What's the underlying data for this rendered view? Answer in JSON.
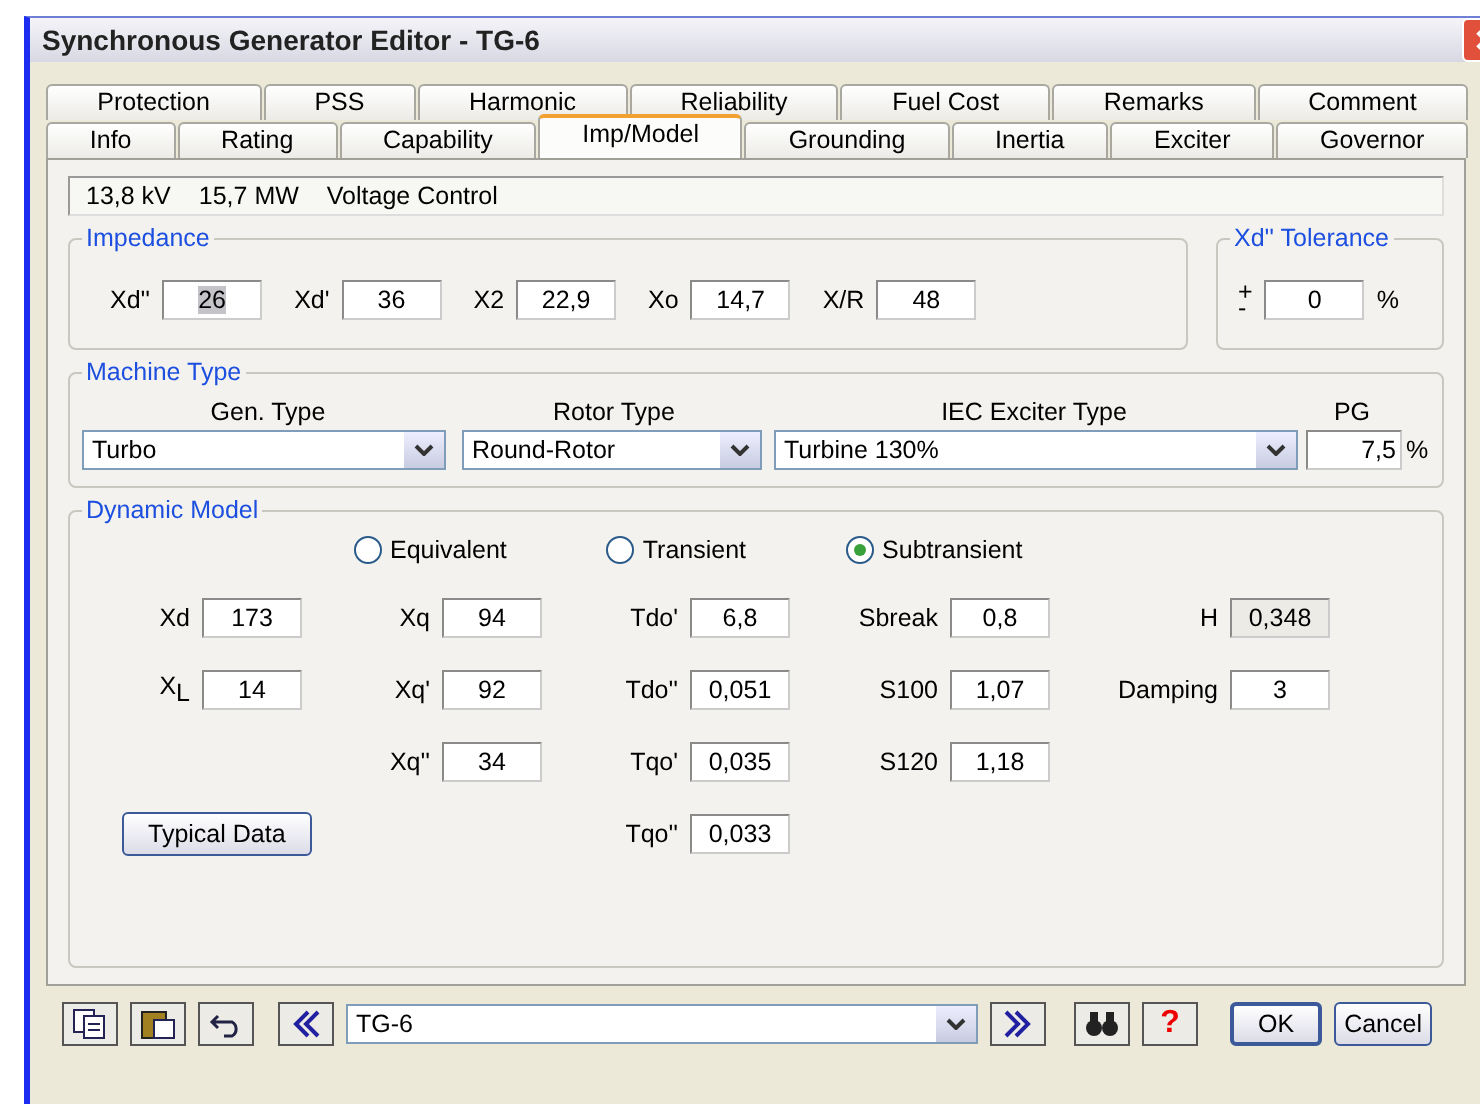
{
  "window": {
    "title": "Synchronous Generator Editor - TG-6"
  },
  "tab_rows": [
    [
      {
        "label": "Protection",
        "selected": false
      },
      {
        "label": "PSS",
        "selected": false
      },
      {
        "label": "Harmonic",
        "selected": false
      },
      {
        "label": "Reliability",
        "selected": false
      },
      {
        "label": "Fuel Cost",
        "selected": false
      },
      {
        "label": "Remarks",
        "selected": false
      },
      {
        "label": "Comment",
        "selected": false
      }
    ],
    [
      {
        "label": "Info",
        "selected": false
      },
      {
        "label": "Rating",
        "selected": false
      },
      {
        "label": "Capability",
        "selected": false
      },
      {
        "label": "Imp/Model",
        "selected": true
      },
      {
        "label": "Grounding",
        "selected": false
      },
      {
        "label": "Inertia",
        "selected": false
      },
      {
        "label": "Exciter",
        "selected": false
      },
      {
        "label": "Governor",
        "selected": false
      }
    ]
  ],
  "info_bar": [
    "13,8 kV",
    "15,7 MW",
    "Voltage Control"
  ],
  "impedance": {
    "title": "Impedance",
    "fields": [
      {
        "label": "Xd''",
        "value": "26",
        "highlighted": true
      },
      {
        "label": "Xd'",
        "value": "36",
        "highlighted": false
      },
      {
        "label": "X2",
        "value": "22,9",
        "highlighted": false
      },
      {
        "label": "Xo",
        "value": "14,7",
        "highlighted": false
      },
      {
        "label": "X/R",
        "value": "48",
        "highlighted": false
      }
    ]
  },
  "tolerance": {
    "title": "Xd'' Tolerance",
    "sign_plus": "+",
    "sign_minus": "-",
    "value": "0",
    "unit": "%"
  },
  "machine_type": {
    "title": "Machine Type",
    "gen_type": {
      "label": "Gen. Type",
      "value": "Turbo"
    },
    "rotor_type": {
      "label": "Rotor Type",
      "value": "Round-Rotor"
    },
    "exciter_type": {
      "label": "IEC Exciter Type",
      "value": "Turbine 130%"
    },
    "pg": {
      "label": "PG",
      "value": "7,5",
      "unit": "%"
    }
  },
  "dynamic_model": {
    "title": "Dynamic Model",
    "options": [
      {
        "label": "Equivalent",
        "selected": false
      },
      {
        "label": "Transient",
        "selected": false
      },
      {
        "label": "Subtransient",
        "selected": true
      }
    ],
    "rows": [
      [
        {
          "kind": "field",
          "label": "Xd",
          "value": "173",
          "disabled": false
        },
        {
          "kind": "field",
          "label": "Xq",
          "value": "94",
          "disabled": false
        },
        {
          "kind": "field",
          "label": "Tdo'",
          "value": "6,8",
          "disabled": false
        },
        {
          "kind": "field",
          "label": "Sbreak",
          "value": "0,8",
          "disabled": false
        },
        {
          "kind": "field",
          "label": "H",
          "value": "0,348",
          "disabled": true
        }
      ],
      [
        {
          "kind": "field",
          "label": "X$_{L}$",
          "value": "14",
          "disabled": false
        },
        {
          "kind": "field",
          "label": "Xq'",
          "value": "92",
          "disabled": false
        },
        {
          "kind": "field",
          "label": "Tdo''",
          "value": "0,051",
          "disabled": false
        },
        {
          "kind": "field",
          "label": "S100",
          "value": "1,07",
          "disabled": false
        },
        {
          "kind": "field",
          "label": "Damping",
          "value": "3",
          "disabled": false
        }
      ],
      [
        {
          "kind": "empty"
        },
        {
          "kind": "field",
          "label": "Xq''",
          "value": "34",
          "disabled": false
        },
        {
          "kind": "field",
          "label": "Tqo'",
          "value": "0,035",
          "disabled": false
        },
        {
          "kind": "field",
          "label": "S120",
          "value": "1,18",
          "disabled": false
        },
        {
          "kind": "empty"
        }
      ],
      [
        {
          "kind": "button",
          "label": "Typical Data"
        },
        {
          "kind": "empty"
        },
        {
          "kind": "field",
          "label": "Tqo''",
          "value": "0,033",
          "disabled": false
        },
        {
          "kind": "empty"
        },
        {
          "kind": "empty"
        }
      ]
    ]
  },
  "footer": {
    "element": "TG-6",
    "help": "?",
    "ok": "OK",
    "cancel": "Cancel"
  }
}
